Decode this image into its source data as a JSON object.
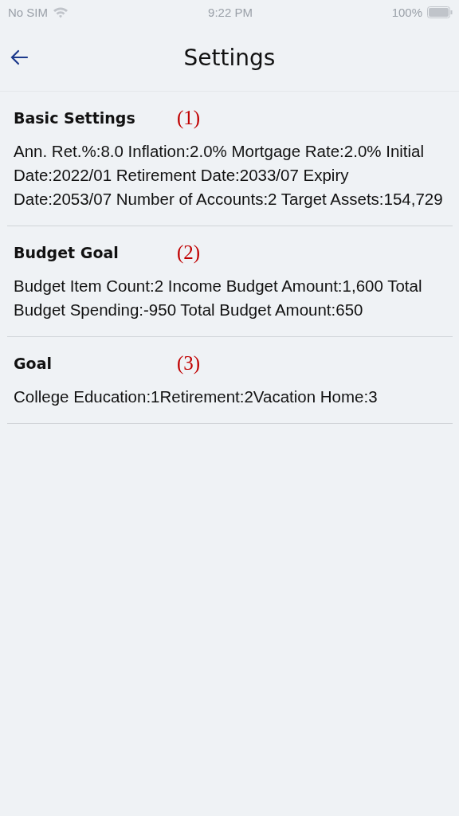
{
  "status_bar": {
    "carrier": "No SIM",
    "time": "9:22 PM",
    "battery": "100%"
  },
  "header": {
    "title": "Settings"
  },
  "sections": [
    {
      "title": "Basic Settings",
      "marker": "(1)",
      "text": "Ann. Ret.%:8.0 Inflation:2.0% Mortgage Rate:2.0% Initial Date:2022/01 Retirement Date:2033/07 Expiry Date:2053/07 Number of Accounts:2 Target Assets:154,729"
    },
    {
      "title": "Budget Goal",
      "marker": "(2)",
      "text": "Budget Item Count:2 Income Budget Amount:1,600 Total Budget Spending:-950 Total Budget Amount:650"
    },
    {
      "title": "Goal",
      "marker": "(3)",
      "text": "College Education:1Retirement:2Vacation Home:3"
    }
  ]
}
